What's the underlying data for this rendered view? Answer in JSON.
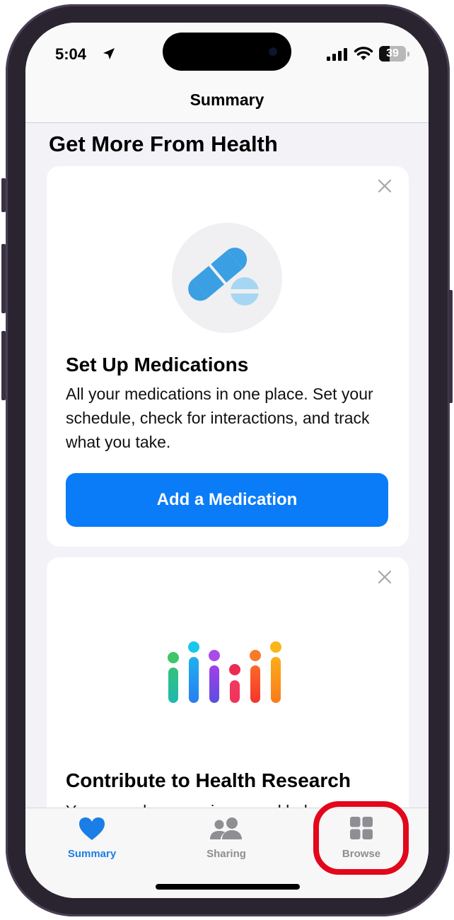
{
  "status_bar": {
    "time": "5:04",
    "battery_level": "39",
    "battery_percent": 39
  },
  "nav": {
    "title": "Summary"
  },
  "section": {
    "title": "Get More From Health"
  },
  "cards": [
    {
      "icon": "pills-icon",
      "heading": "Set Up Medications",
      "body": "All your medications in one place. Set your schedule, check for interactions, and track what you take.",
      "button_label": "Add a Medication"
    },
    {
      "icon": "research-bars-icon",
      "heading": "Contribute to Health Research",
      "body": "You can advance science and help"
    }
  ],
  "tab_bar": {
    "tabs": [
      {
        "label": "Summary",
        "icon": "heart-icon",
        "active": true
      },
      {
        "label": "Sharing",
        "icon": "people-icon",
        "active": false
      },
      {
        "label": "Browse",
        "icon": "grid-icon",
        "active": false
      }
    ]
  },
  "colors": {
    "accent": "#0a7cf8",
    "tab_active": "#1a7ee6",
    "tab_inactive": "#8e8e93",
    "annotation": "#e2071a"
  }
}
